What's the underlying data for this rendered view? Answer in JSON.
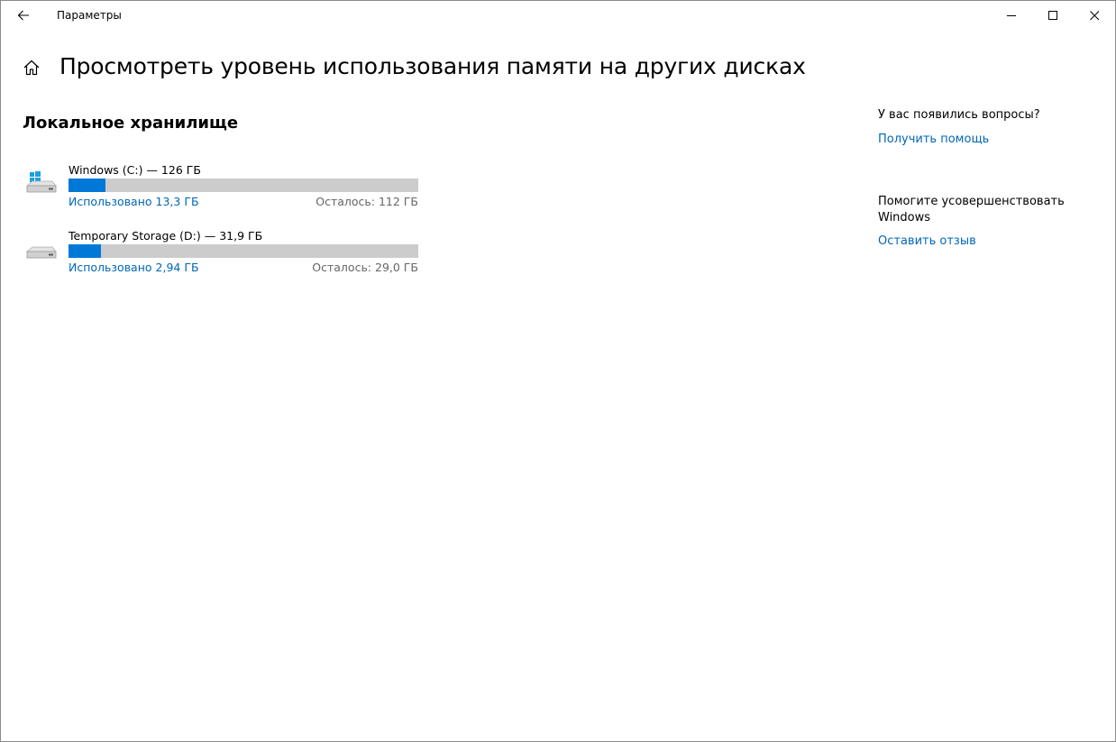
{
  "window": {
    "title": "Параметры",
    "back_icon": "arrow-left-icon",
    "minimize_icon": "minimize-icon",
    "maximize_icon": "maximize-icon",
    "close_icon": "close-icon"
  },
  "header": {
    "home_icon": "home-icon",
    "title": "Просмотреть уровень использования памяти на других дисках"
  },
  "storage": {
    "section_title": "Локальное хранилище",
    "drives": [
      {
        "name": "Windows (C:) — 126 ГБ",
        "icon": "windows-drive-icon",
        "used_label": "Использовано 13,3 ГБ",
        "free_label": "Осталось: 112 ГБ",
        "used_fraction": 0.106
      },
      {
        "name": "Temporary Storage (D:) — 31,9 ГБ",
        "icon": "drive-icon",
        "used_label": "Использовано 2,94 ГБ",
        "free_label": "Осталось: 29,0 ГБ",
        "used_fraction": 0.092
      }
    ]
  },
  "sidebar": {
    "questions_heading": "У вас появились вопросы?",
    "help_link": "Получить помощь",
    "improve_heading": "Помогите усовершенствовать Windows",
    "feedback_link": "Оставить отзыв"
  },
  "colors": {
    "accent": "#0078d7",
    "link": "#0067b8",
    "bar_track": "#cccccc"
  }
}
